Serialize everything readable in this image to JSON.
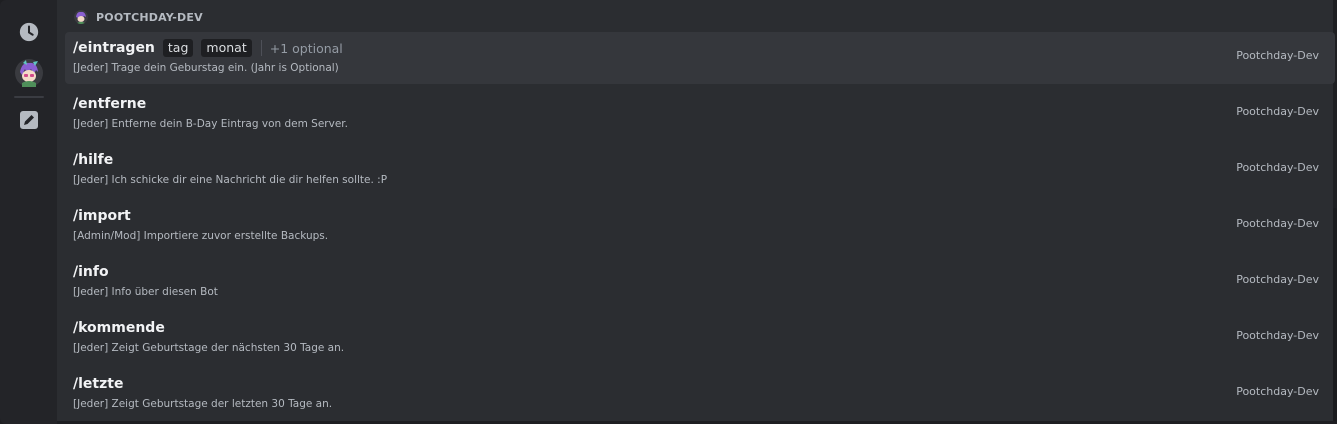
{
  "section": {
    "title": "POOTCHDAY-DEV"
  },
  "rail": {
    "items": [
      "clock-icon",
      "bot-avatar",
      "pencil-icon"
    ]
  },
  "commands": [
    {
      "name": "/eintragen",
      "options": [
        "tag",
        "monat"
      ],
      "extra": "+1 optional",
      "description": "[Jeder] Trage dein Geburstag ein. (Jahr is Optional)",
      "source": "Pootchday-Dev",
      "selected": true
    },
    {
      "name": "/entferne",
      "description": "[Jeder] Entferne dein B-Day Eintrag von dem Server.",
      "source": "Pootchday-Dev"
    },
    {
      "name": "/hilfe",
      "description": "[Jeder] Ich schicke dir eine Nachricht die dir helfen sollte. :P",
      "source": "Pootchday-Dev"
    },
    {
      "name": "/import",
      "description": "[Admin/Mod] Importiere zuvor erstellte Backups.",
      "source": "Pootchday-Dev"
    },
    {
      "name": "/info",
      "description": "[Jeder] Info über diesen Bot",
      "source": "Pootchday-Dev"
    },
    {
      "name": "/kommende",
      "description": "[Jeder] Zeigt Geburtstage der nächsten 30 Tage an.",
      "source": "Pootchday-Dev"
    },
    {
      "name": "/letzte",
      "description": "[Jeder] Zeigt Geburtstage der letzten 30 Tage an.",
      "source": "Pootchday-Dev"
    }
  ],
  "colors": {
    "background": "#1e1f22",
    "panel": "#2b2d31",
    "selected_row": "#35373c",
    "text_primary": "#f2f3f5",
    "text_muted": "#b5bac1"
  }
}
